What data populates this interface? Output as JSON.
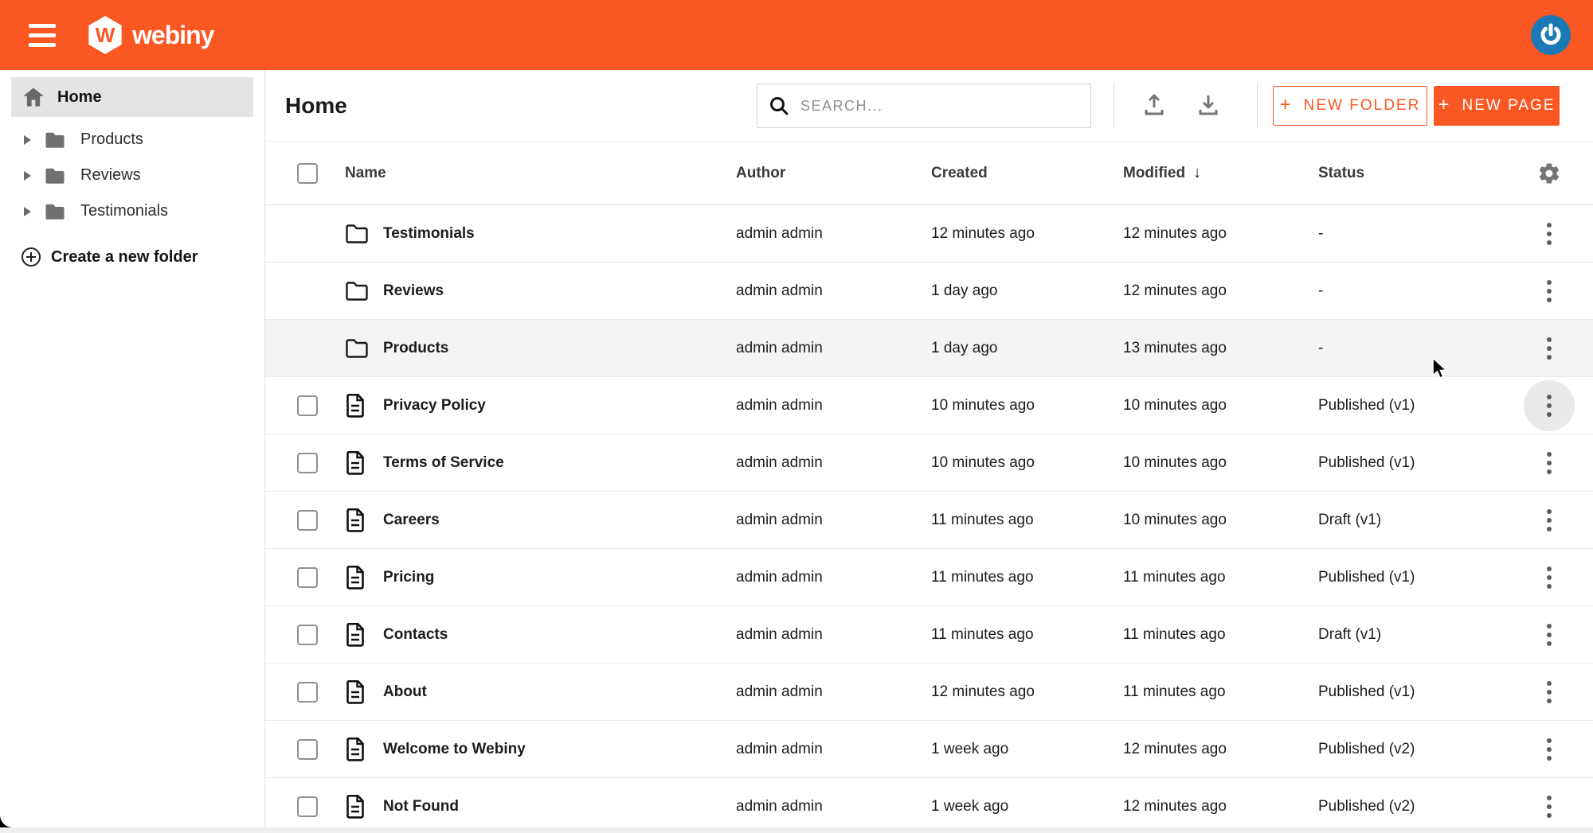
{
  "topbar": {
    "brand": "webiny",
    "brand_initial": "W",
    "accent_color": "#fa5723",
    "avatar_color": "#1b7ab5"
  },
  "sidebar": {
    "home_label": "Home",
    "folders": [
      {
        "label": "Products"
      },
      {
        "label": "Reviews"
      },
      {
        "label": "Testimonials"
      }
    ],
    "create_folder_label": "Create a new folder"
  },
  "toolbar": {
    "title": "Home",
    "search_placeholder": "SEARCH...",
    "search_value": "",
    "plus": "+",
    "new_folder_label": "NEW FOLDER",
    "new_page_label": "NEW PAGE"
  },
  "table": {
    "columns": {
      "name": "Name",
      "author": "Author",
      "created": "Created",
      "modified": "Modified",
      "status": "Status"
    },
    "sort": {
      "column": "Modified",
      "direction": "desc",
      "arrow": "↓"
    },
    "rows": [
      {
        "type": "folder",
        "name": "Testimonials",
        "author": "admin admin",
        "created": "12 minutes ago",
        "modified": "12 minutes ago",
        "status": "-"
      },
      {
        "type": "folder",
        "name": "Reviews",
        "author": "admin admin",
        "created": "1 day ago",
        "modified": "12 minutes ago",
        "status": "-"
      },
      {
        "type": "folder",
        "name": "Products",
        "author": "admin admin",
        "created": "1 day ago",
        "modified": "13 minutes ago",
        "status": "-",
        "hover": true
      },
      {
        "type": "page",
        "name": "Privacy Policy",
        "author": "admin admin",
        "created": "10 minutes ago",
        "modified": "10 minutes ago",
        "status": "Published (v1)",
        "kebab_focus": true
      },
      {
        "type": "page",
        "name": "Terms of Service",
        "author": "admin admin",
        "created": "10 minutes ago",
        "modified": "10 minutes ago",
        "status": "Published (v1)"
      },
      {
        "type": "page",
        "name": "Careers",
        "author": "admin admin",
        "created": "11 minutes ago",
        "modified": "10 minutes ago",
        "status": "Draft (v1)"
      },
      {
        "type": "page",
        "name": "Pricing",
        "author": "admin admin",
        "created": "11 minutes ago",
        "modified": "11 minutes ago",
        "status": "Published (v1)"
      },
      {
        "type": "page",
        "name": "Contacts",
        "author": "admin admin",
        "created": "11 minutes ago",
        "modified": "11 minutes ago",
        "status": "Draft (v1)"
      },
      {
        "type": "page",
        "name": "About",
        "author": "admin admin",
        "created": "12 minutes ago",
        "modified": "11 minutes ago",
        "status": "Published (v1)"
      },
      {
        "type": "page",
        "name": "Welcome to Webiny",
        "author": "admin admin",
        "created": "1 week ago",
        "modified": "12 minutes ago",
        "status": "Published (v2)"
      },
      {
        "type": "page",
        "name": "Not Found",
        "author": "admin admin",
        "created": "1 week ago",
        "modified": "12 minutes ago",
        "status": "Published (v2)"
      }
    ]
  }
}
